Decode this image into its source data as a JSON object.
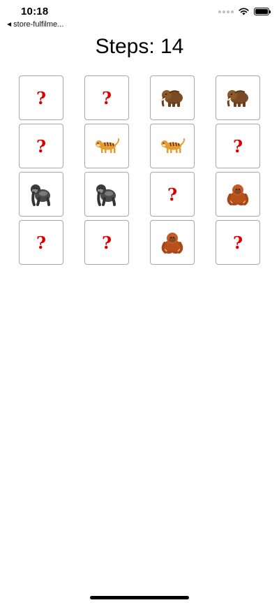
{
  "status_bar": {
    "time": "10:18",
    "back_label": "store-fulfilme..."
  },
  "header": {
    "steps_label": "Steps: 14"
  },
  "colors": {
    "question_mark": "#d60000",
    "card_border": "#a8a8a8"
  },
  "cards": [
    {
      "state": "hidden",
      "label": "?"
    },
    {
      "state": "hidden",
      "label": "?"
    },
    {
      "state": "revealed",
      "icon": "mammoth-icon"
    },
    {
      "state": "revealed",
      "icon": "mammoth-icon"
    },
    {
      "state": "hidden",
      "label": "?"
    },
    {
      "state": "revealed",
      "icon": "tiger-icon"
    },
    {
      "state": "revealed",
      "icon": "tiger-icon"
    },
    {
      "state": "hidden",
      "label": "?"
    },
    {
      "state": "revealed",
      "icon": "gorilla-icon"
    },
    {
      "state": "revealed",
      "icon": "gorilla-icon"
    },
    {
      "state": "hidden",
      "label": "?"
    },
    {
      "state": "revealed",
      "icon": "orangutan-icon"
    },
    {
      "state": "hidden",
      "label": "?"
    },
    {
      "state": "hidden",
      "label": "?"
    },
    {
      "state": "revealed",
      "icon": "orangutan-icon"
    },
    {
      "state": "hidden",
      "label": "?"
    }
  ]
}
